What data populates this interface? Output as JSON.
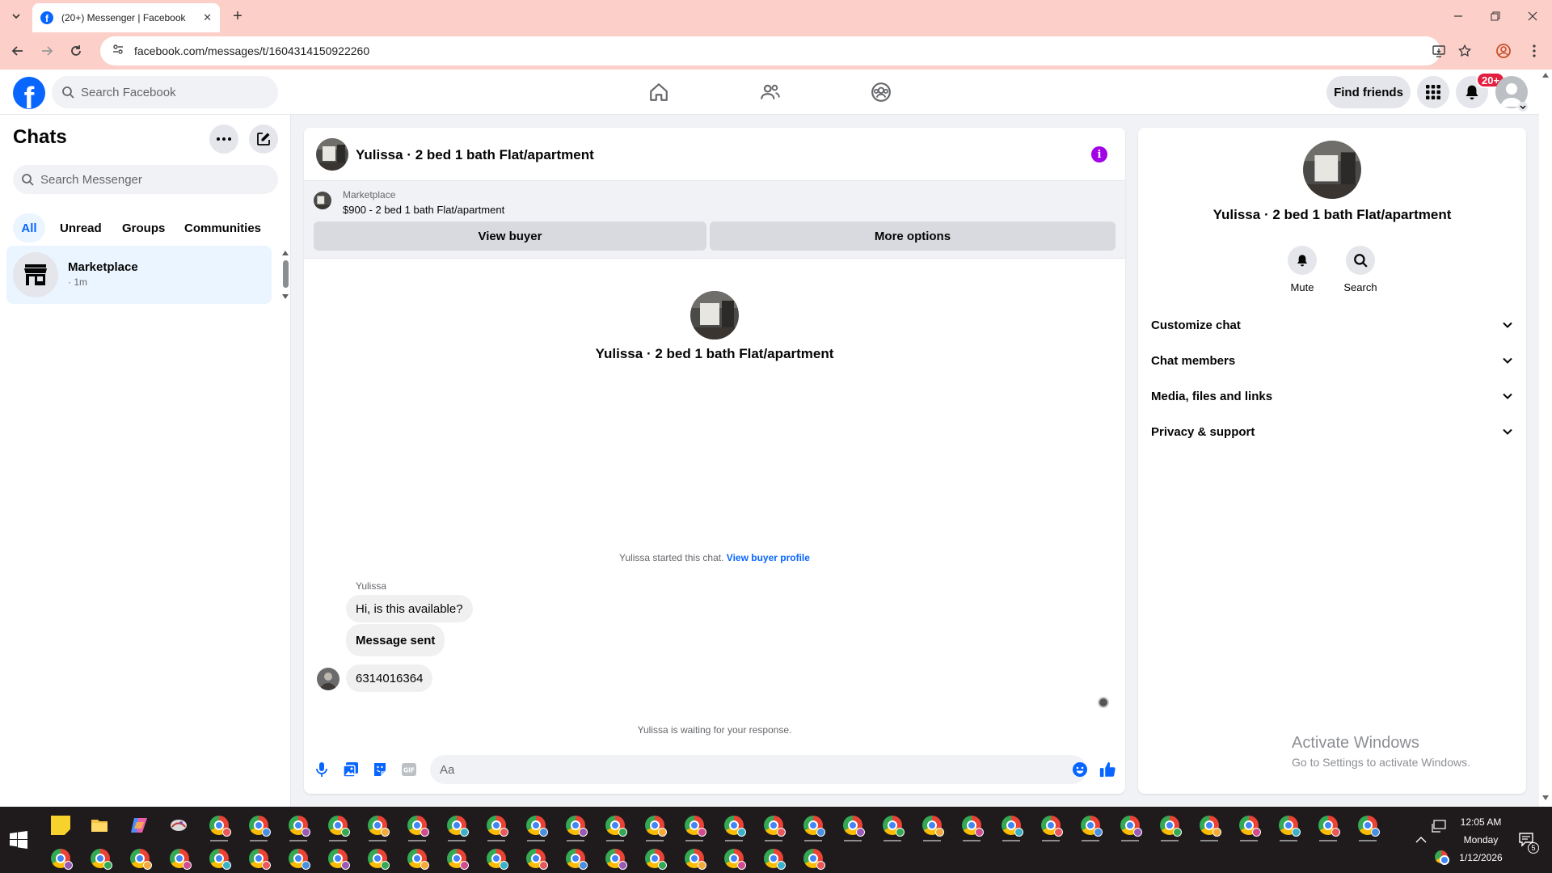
{
  "browser": {
    "tab_title": "(20+) Messenger | Facebook",
    "url": "facebook.com/messages/t/1604314150922260"
  },
  "fb_header": {
    "search_placeholder": "Search Facebook",
    "find_friends_label": "Find friends",
    "notification_badge": "20+"
  },
  "sidebar": {
    "title": "Chats",
    "search_placeholder": "Search Messenger",
    "filters": [
      "All",
      "Unread",
      "Groups",
      "Communities"
    ],
    "active_filter": "All",
    "chats": [
      {
        "name": "Marketplace",
        "time": "· 1m"
      }
    ]
  },
  "chat": {
    "title": "Yulissa · 2 bed 1 bath Flat/apartment",
    "marketplace_label": "Marketplace",
    "listing": "$900 - 2 bed 1 bath Flat/apartment",
    "view_buyer_label": "View buyer",
    "more_options_label": "More options",
    "center_name": "Yulissa · 2 bed 1 bath Flat/apartment",
    "started_note": "Yulissa started this chat.",
    "view_profile_link": "View buyer profile",
    "sender": "Yulissa",
    "messages": [
      {
        "text": "Hi, is this available?"
      },
      {
        "text": "Message sent"
      },
      {
        "text": "6314016364"
      }
    ],
    "waiting_note": "Yulissa is waiting for your response.",
    "composer_placeholder": "Aa"
  },
  "info_panel": {
    "name": "Yulissa · 2 bed 1 bath Flat/apartment",
    "actions": [
      {
        "label": "Mute",
        "icon": "bell-icon"
      },
      {
        "label": "Search",
        "icon": "search-icon"
      }
    ],
    "sections": [
      "Customize chat",
      "Chat members",
      "Media, files and links",
      "Privacy & support"
    ]
  },
  "watermark": {
    "line1": "Activate Windows",
    "line2": "Go to Settings to activate Windows."
  },
  "taskbar": {
    "time": "12:05 AM",
    "day": "Monday",
    "date": "1/12/2026",
    "notification_count": "5"
  },
  "colors": {
    "fb_blue": "#0866ff",
    "tab_strip": "#fccfc8",
    "info_purple": "#a200e6",
    "badge_red": "#e41e3f"
  }
}
